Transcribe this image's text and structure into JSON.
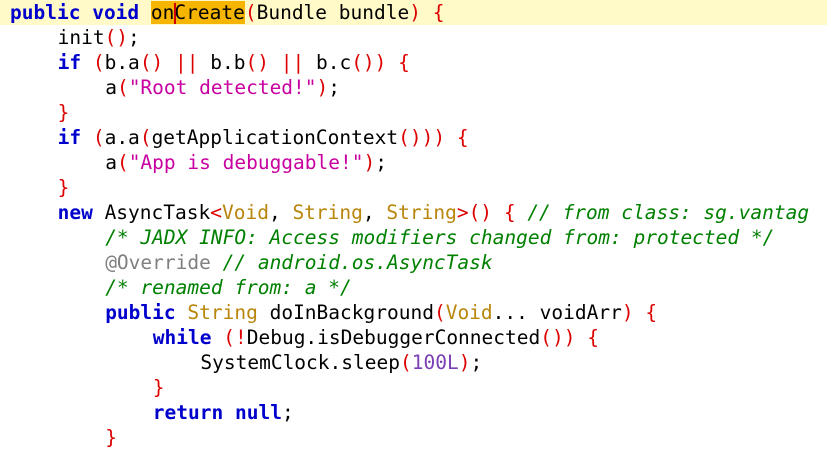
{
  "editor": {
    "highlight_color": "#f6b500",
    "current_line_color": "#fffac8",
    "caret_color": "#cc0000",
    "lines": [
      {
        "indent": 0,
        "current": true,
        "tokens": [
          {
            "t": "kw",
            "v": "public"
          },
          {
            "t": "plain",
            "v": " "
          },
          {
            "t": "kw",
            "v": "void"
          },
          {
            "t": "plain",
            "v": " "
          },
          {
            "t": "hl",
            "v": "onCreate",
            "caret_after": 2
          },
          {
            "t": "punc",
            "v": "("
          },
          {
            "t": "plain",
            "v": "Bundle bundle"
          },
          {
            "t": "punc",
            "v": ")"
          },
          {
            "t": "plain",
            "v": " "
          },
          {
            "t": "punc",
            "v": "{"
          }
        ]
      },
      {
        "indent": 4,
        "tokens": [
          {
            "t": "plain",
            "v": "init"
          },
          {
            "t": "punc",
            "v": "()"
          },
          {
            "t": "plain",
            "v": ";"
          }
        ]
      },
      {
        "indent": 4,
        "tokens": [
          {
            "t": "kw",
            "v": "if"
          },
          {
            "t": "plain",
            "v": " "
          },
          {
            "t": "punc",
            "v": "("
          },
          {
            "t": "plain",
            "v": "b.a"
          },
          {
            "t": "punc",
            "v": "()"
          },
          {
            "t": "plain",
            "v": " "
          },
          {
            "t": "punc",
            "v": "||"
          },
          {
            "t": "plain",
            "v": " b.b"
          },
          {
            "t": "punc",
            "v": "()"
          },
          {
            "t": "plain",
            "v": " "
          },
          {
            "t": "punc",
            "v": "||"
          },
          {
            "t": "plain",
            "v": " b.c"
          },
          {
            "t": "punc",
            "v": "())"
          },
          {
            "t": "plain",
            "v": " "
          },
          {
            "t": "punc",
            "v": "{"
          }
        ]
      },
      {
        "indent": 8,
        "tokens": [
          {
            "t": "plain",
            "v": "a"
          },
          {
            "t": "punc",
            "v": "("
          },
          {
            "t": "str",
            "v": "\"Root detected!\""
          },
          {
            "t": "punc",
            "v": ")"
          },
          {
            "t": "plain",
            "v": ";"
          }
        ]
      },
      {
        "indent": 4,
        "tokens": [
          {
            "t": "punc",
            "v": "}"
          }
        ]
      },
      {
        "indent": 4,
        "tokens": [
          {
            "t": "kw",
            "v": "if"
          },
          {
            "t": "plain",
            "v": " "
          },
          {
            "t": "punc",
            "v": "("
          },
          {
            "t": "plain",
            "v": "a.a"
          },
          {
            "t": "punc",
            "v": "("
          },
          {
            "t": "plain",
            "v": "getApplicationContext"
          },
          {
            "t": "punc",
            "v": "()))"
          },
          {
            "t": "plain",
            "v": " "
          },
          {
            "t": "punc",
            "v": "{"
          }
        ]
      },
      {
        "indent": 8,
        "tokens": [
          {
            "t": "plain",
            "v": "a"
          },
          {
            "t": "punc",
            "v": "("
          },
          {
            "t": "str",
            "v": "\"App is debuggable!\""
          },
          {
            "t": "punc",
            "v": ")"
          },
          {
            "t": "plain",
            "v": ";"
          }
        ]
      },
      {
        "indent": 4,
        "tokens": [
          {
            "t": "punc",
            "v": "}"
          }
        ]
      },
      {
        "indent": 4,
        "tokens": [
          {
            "t": "kw",
            "v": "new"
          },
          {
            "t": "plain",
            "v": " AsyncTask"
          },
          {
            "t": "punc",
            "v": "<"
          },
          {
            "t": "typ",
            "v": "Void"
          },
          {
            "t": "plain",
            "v": ", "
          },
          {
            "t": "typ",
            "v": "String"
          },
          {
            "t": "plain",
            "v": ", "
          },
          {
            "t": "typ",
            "v": "String"
          },
          {
            "t": "punc",
            "v": ">()"
          },
          {
            "t": "plain",
            "v": " "
          },
          {
            "t": "punc",
            "v": "{"
          },
          {
            "t": "plain",
            "v": " "
          },
          {
            "t": "cmt",
            "v": "// from class: sg.vantag"
          }
        ]
      },
      {
        "indent": 8,
        "tokens": [
          {
            "t": "cmt",
            "v": "/* JADX INFO: Access modifiers changed from: protected */"
          }
        ]
      },
      {
        "indent": 8,
        "tokens": [
          {
            "t": "ann",
            "v": "@Override"
          },
          {
            "t": "plain",
            "v": " "
          },
          {
            "t": "cmt",
            "v": "// android.os.AsyncTask"
          }
        ]
      },
      {
        "indent": 8,
        "tokens": [
          {
            "t": "cmt",
            "v": "/* renamed from: a */"
          }
        ]
      },
      {
        "indent": 8,
        "tokens": [
          {
            "t": "kw",
            "v": "public"
          },
          {
            "t": "plain",
            "v": " "
          },
          {
            "t": "typ",
            "v": "String"
          },
          {
            "t": "plain",
            "v": " doInBackground"
          },
          {
            "t": "punc",
            "v": "("
          },
          {
            "t": "typ",
            "v": "Void"
          },
          {
            "t": "plain",
            "v": "... voidArr"
          },
          {
            "t": "punc",
            "v": ")"
          },
          {
            "t": "plain",
            "v": " "
          },
          {
            "t": "punc",
            "v": "{"
          }
        ]
      },
      {
        "indent": 12,
        "tokens": [
          {
            "t": "kw",
            "v": "while"
          },
          {
            "t": "plain",
            "v": " "
          },
          {
            "t": "punc",
            "v": "(!"
          },
          {
            "t": "plain",
            "v": "Debug.isDebuggerConnected"
          },
          {
            "t": "punc",
            "v": "())"
          },
          {
            "t": "plain",
            "v": " "
          },
          {
            "t": "punc",
            "v": "{"
          }
        ]
      },
      {
        "indent": 16,
        "tokens": [
          {
            "t": "plain",
            "v": "SystemClock.sleep"
          },
          {
            "t": "punc",
            "v": "("
          },
          {
            "t": "num",
            "v": "100L"
          },
          {
            "t": "punc",
            "v": ")"
          },
          {
            "t": "plain",
            "v": ";"
          }
        ]
      },
      {
        "indent": 12,
        "tokens": [
          {
            "t": "punc",
            "v": "}"
          }
        ]
      },
      {
        "indent": 12,
        "tokens": [
          {
            "t": "kw",
            "v": "return"
          },
          {
            "t": "plain",
            "v": " "
          },
          {
            "t": "kw",
            "v": "null"
          },
          {
            "t": "plain",
            "v": ";"
          }
        ]
      },
      {
        "indent": 8,
        "tokens": [
          {
            "t": "punc",
            "v": "}"
          }
        ]
      }
    ]
  }
}
